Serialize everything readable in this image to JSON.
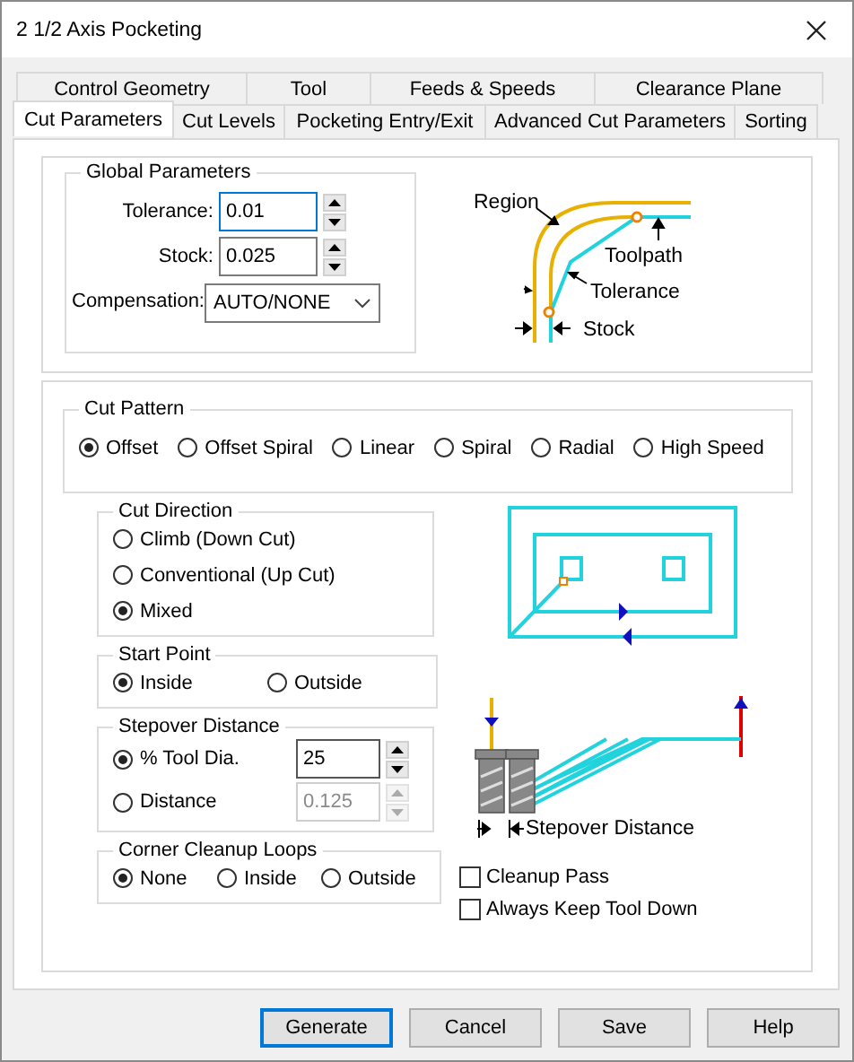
{
  "window": {
    "title": "2 1/2 Axis Pocketing"
  },
  "tabs_back": [
    {
      "label": "Control Geometry",
      "selected": false
    },
    {
      "label": "Tool",
      "selected": false
    },
    {
      "label": "Feeds & Speeds",
      "selected": false
    },
    {
      "label": "Clearance Plane",
      "selected": false
    }
  ],
  "tabs_front": [
    {
      "label": "Cut Parameters",
      "selected": true
    },
    {
      "label": "Cut Levels",
      "selected": false
    },
    {
      "label": "Pocketing Entry/Exit",
      "selected": false
    },
    {
      "label": "Advanced Cut Parameters",
      "selected": false
    },
    {
      "label": "Sorting",
      "selected": false
    }
  ],
  "global_parameters": {
    "title": "Global Parameters",
    "fields": [
      {
        "label": "Tolerance:",
        "value": "0.01",
        "focused": true
      },
      {
        "label": "Stock:",
        "value": "0.025",
        "focused": false
      }
    ],
    "compensation": {
      "label": "Compensation:",
      "value": "AUTO/NONE"
    }
  },
  "region_diagram": {
    "labels": [
      "Region",
      "Toolpath",
      "Tolerance",
      "Stock"
    ]
  },
  "cut_pattern": {
    "title": "Cut Pattern",
    "options": [
      {
        "label": "Offset",
        "selected": true
      },
      {
        "label": "Offset Spiral",
        "selected": false
      },
      {
        "label": "Linear",
        "selected": false
      },
      {
        "label": "Spiral",
        "selected": false
      },
      {
        "label": "Radial",
        "selected": false
      },
      {
        "label": "High Speed",
        "selected": false
      }
    ]
  },
  "cut_direction": {
    "title": "Cut Direction",
    "options": [
      {
        "label": "Climb (Down Cut)",
        "selected": false
      },
      {
        "label": "Conventional (Up Cut)",
        "selected": false
      },
      {
        "label": "Mixed",
        "selected": true
      }
    ]
  },
  "start_point": {
    "title": "Start Point",
    "options": [
      {
        "label": "Inside",
        "selected": true
      },
      {
        "label": "Outside",
        "selected": false
      }
    ]
  },
  "stepover": {
    "title": "Stepover Distance",
    "options": [
      {
        "label": "% Tool Dia.",
        "selected": true,
        "value": "25"
      },
      {
        "label": "Distance",
        "selected": false,
        "value": "0.125"
      }
    ]
  },
  "stepover_diagram": {
    "label": "Stepover Distance"
  },
  "corner_cleanup": {
    "title": "Corner Cleanup Loops",
    "options": [
      {
        "label": "None",
        "selected": true
      },
      {
        "label": "Inside",
        "selected": false
      },
      {
        "label": "Outside",
        "selected": false
      }
    ]
  },
  "checkboxes": [
    {
      "label": "Cleanup Pass",
      "checked": false
    },
    {
      "label": "Always Keep Tool Down",
      "checked": false
    }
  ],
  "buttons": [
    {
      "label": "Generate",
      "default": true
    },
    {
      "label": "Cancel",
      "default": false
    },
    {
      "label": "Save",
      "default": false
    },
    {
      "label": "Help",
      "default": false
    }
  ]
}
